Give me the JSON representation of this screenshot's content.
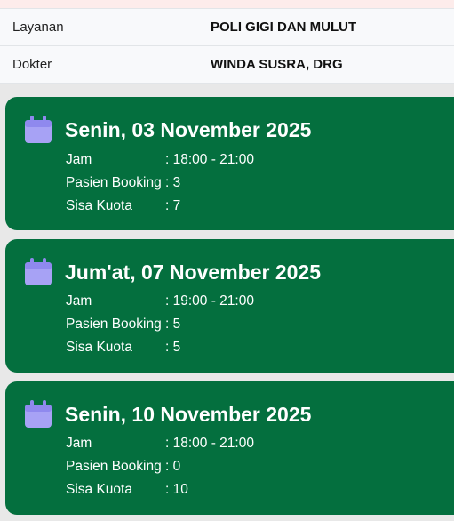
{
  "info": {
    "rows": [
      {
        "label": "Layanan",
        "value": "POLI GIGI DAN MULUT"
      },
      {
        "label": "Dokter",
        "value": "WINDA SUSRA, DRG"
      }
    ]
  },
  "labels": {
    "jam": "Jam",
    "pasien_booking": "Pasien Booking",
    "sisa_kuota": "Sisa Kuota",
    "separator": ":"
  },
  "schedules": [
    {
      "date": "Senin, 03 November 2025",
      "jam": "18:00 - 21:00",
      "pasien_booking": "3",
      "sisa_kuota": "7"
    },
    {
      "date": "Jum'at, 07 November 2025",
      "jam": "19:00 - 21:00",
      "pasien_booking": "5",
      "sisa_kuota": "5"
    },
    {
      "date": "Senin, 10 November 2025",
      "jam": "18:00 - 21:00",
      "pasien_booking": "0",
      "sisa_kuota": "10"
    }
  ],
  "colors": {
    "card_bg": "#046f3e",
    "icon": "#a7a2f5"
  },
  "icons": {
    "schedule": "calendar-icon"
  }
}
